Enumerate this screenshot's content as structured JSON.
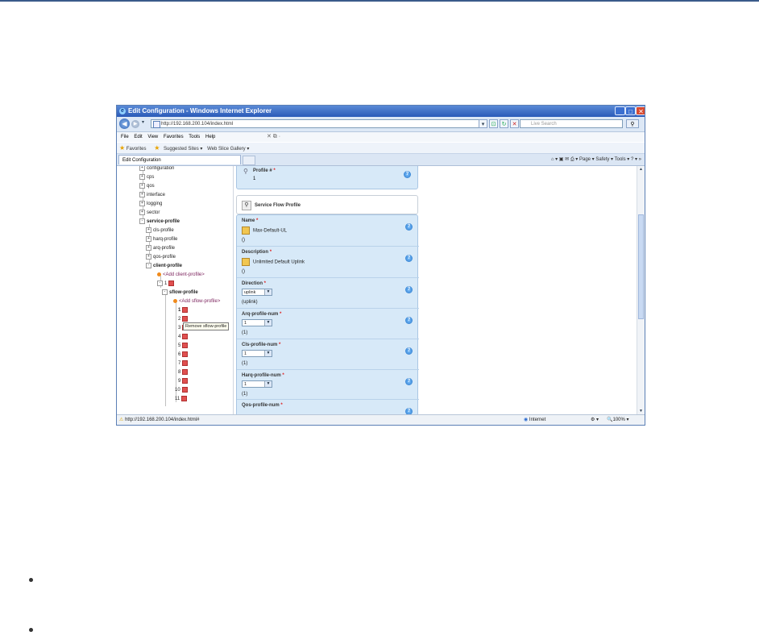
{
  "window": {
    "title": "Edit Configuration - Windows Internet Explorer",
    "address": "http://192.168.200.104/index.html",
    "search_placeholder": "Live Search",
    "menu": [
      "File",
      "Edit",
      "View",
      "Favorites",
      "Tools",
      "Help"
    ],
    "favorites_label": "Favorites",
    "suggested_sites": "Suggested Sites ▾",
    "web_slice_gallery": "Web Slice Gallery ▾",
    "tab_label": "Edit Configuration",
    "command_bar": "Page ▾  Safety ▾  Tools ▾",
    "status_url": "http://192.168.200.104/index.html#",
    "status_zone": "Internet",
    "zoom": "100%"
  },
  "tree": {
    "items": [
      {
        "label": "configuration",
        "pm": "+"
      },
      {
        "label": "cps",
        "pm": "+"
      },
      {
        "label": "qos",
        "pm": "+"
      },
      {
        "label": "interface",
        "pm": "+"
      },
      {
        "label": "logging",
        "pm": "+"
      },
      {
        "label": "sector",
        "pm": "+"
      },
      {
        "label": "service-profile",
        "pm": "-"
      },
      {
        "label": "cls-profile",
        "pm": "+"
      },
      {
        "label": "harq-profile",
        "pm": "+"
      },
      {
        "label": "arq-profile",
        "pm": "+"
      },
      {
        "label": "qos-profile",
        "pm": "+"
      },
      {
        "label": "client-profile",
        "pm": "-"
      },
      {
        "label": "<Add client-profile>"
      },
      {
        "label": "1"
      },
      {
        "label": "sflow-profile",
        "pm": "-"
      },
      {
        "label": "<Add sflow-profile>"
      },
      {
        "label": "1"
      },
      {
        "label": "2"
      },
      {
        "label": "3"
      },
      {
        "label": "4"
      },
      {
        "label": "5"
      },
      {
        "label": "6"
      },
      {
        "label": "7"
      },
      {
        "label": "8"
      },
      {
        "label": "9"
      },
      {
        "label": "10"
      },
      {
        "label": "11"
      }
    ],
    "tooltip": "Remove sflow-profile"
  },
  "form": {
    "profile_label": "Profile #",
    "profile_value": "1",
    "section_title": "Service Flow Profile",
    "fields": [
      {
        "label": "Name",
        "value": "Max-Default-UL",
        "sub": "()"
      },
      {
        "label": "Description",
        "value": "Unlimited Default Uplink",
        "sub": "()"
      },
      {
        "label": "Direction",
        "select": "uplink",
        "sub": "(uplink)"
      },
      {
        "label": "Arq-profile-num",
        "select": "1",
        "sub": "(1)"
      },
      {
        "label": "Cls-profile-num",
        "select": "1",
        "sub": "(1)"
      },
      {
        "label": "Harq-profile-num",
        "select": "1",
        "sub": "(1)"
      },
      {
        "label": "Qos-profile-num"
      }
    ],
    "required_mark": "*"
  }
}
